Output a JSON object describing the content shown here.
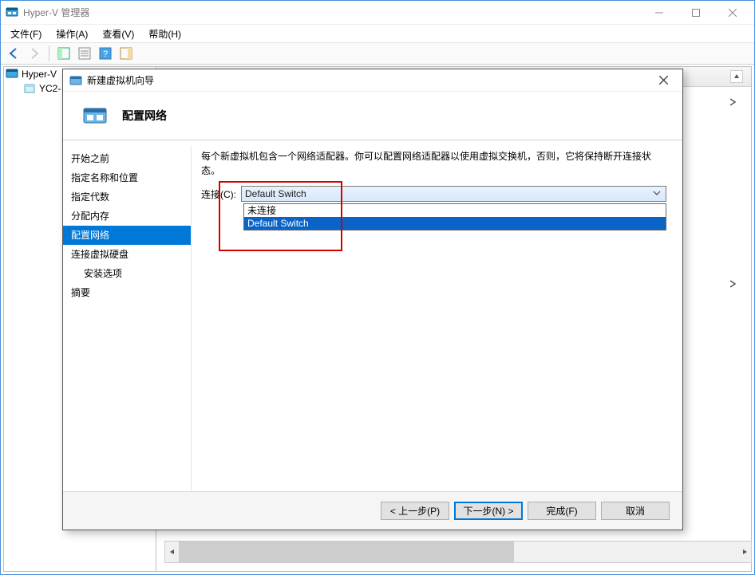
{
  "main_window": {
    "title": "Hyper-V 管理器",
    "menus": {
      "file": "文件(F)",
      "action": "操作(A)",
      "view": "查看(V)",
      "help": "帮助(H)"
    },
    "tree": {
      "root": "Hyper-V",
      "child": "YC2-"
    }
  },
  "wizard": {
    "window_title": "新建虚拟机向导",
    "header_title": "配置网络",
    "nav": {
      "before_start": "开始之前",
      "name_location": "指定名称和位置",
      "generation": "指定代数",
      "memory": "分配内存",
      "network": "配置网络",
      "vhd": "连接虚拟硬盘",
      "install_opts": "安装选项",
      "summary": "摘要"
    },
    "content": {
      "description": "每个新虚拟机包含一个网络适配器。你可以配置网络适配器以使用虚拟交换机，否则，它将保持断开连接状态。",
      "connection_label": "连接(C):",
      "selected": "Default Switch",
      "options": {
        "not_connected": "未连接",
        "default_switch": "Default Switch"
      }
    },
    "buttons": {
      "previous": "< 上一步(P)",
      "next": "下一步(N) >",
      "finish": "完成(F)",
      "cancel": "取消"
    }
  }
}
